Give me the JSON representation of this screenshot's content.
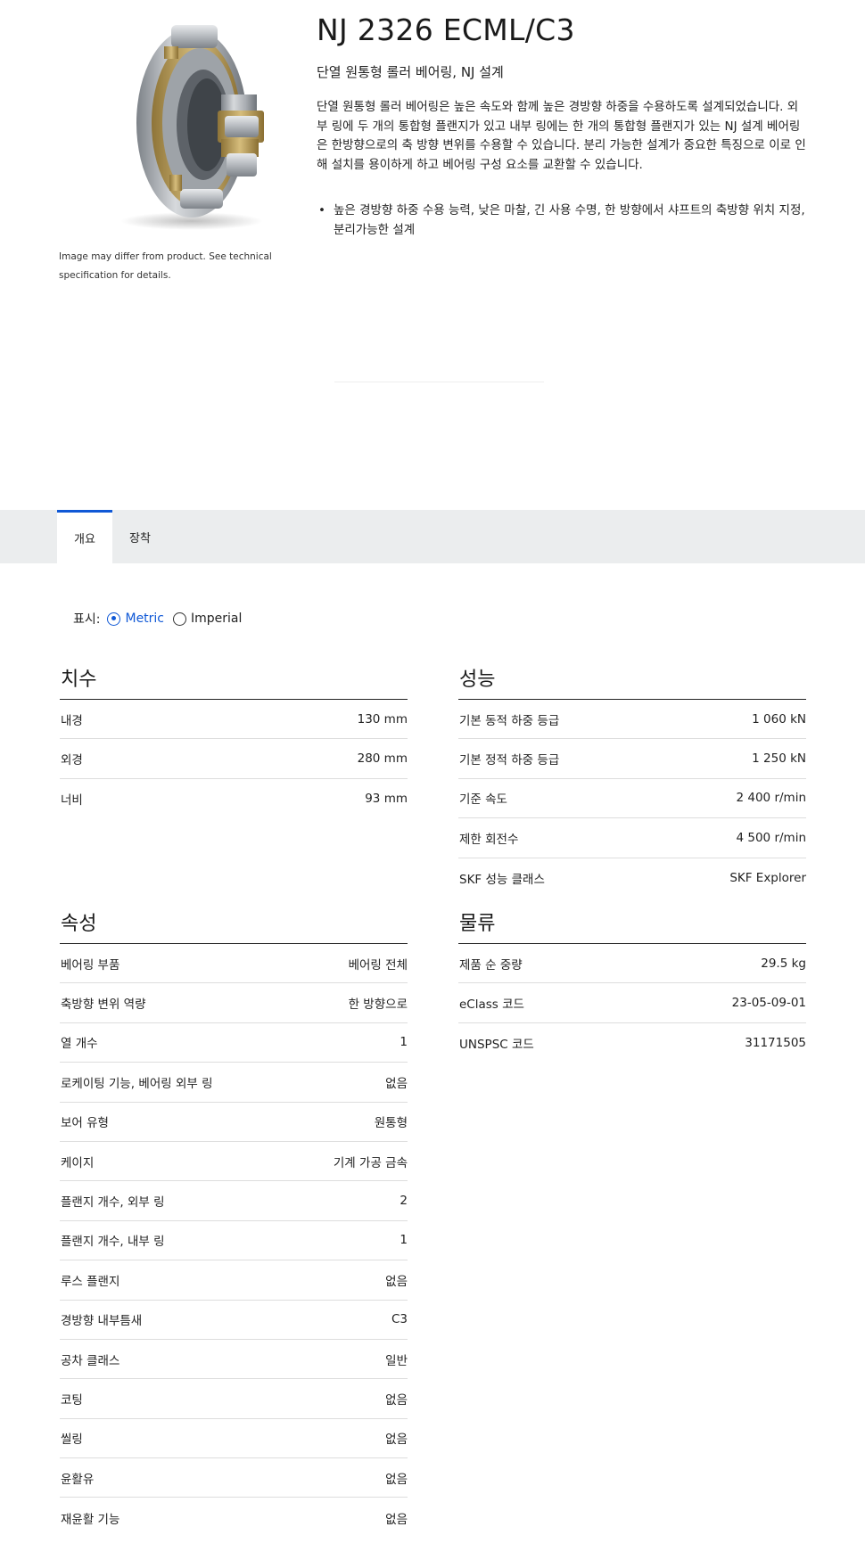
{
  "product": {
    "title": "NJ 2326 ECML/C3",
    "subtitle": "단열 원통형 롤러 베어링, NJ 설계",
    "description": "단열 원통형 롤러 베어링은 높은 속도와 함께 높은 경방향 하중을 수용하도록 설계되었습니다. 외부 링에 두 개의 통합형 플랜지가 있고 내부 링에는 한 개의 통합형 플랜지가 있는 NJ 설계 베어링은 한방향으로의 축 방향 변위를 수용할 수 있습니다. 분리 가능한 설계가 중요한 특징으로 이로 인해 설치를 용이하게 하고 베어링 구성 요소를 교환할 수 있습니다.",
    "benefits": [
      "높은 경방향 하중 수용 능력, 낮은 마찰, 긴 사용 수명, 한 방향에서 샤프트의 축방향 위치 지정, 분리가능한 설계"
    ],
    "image_note": "Image may differ from product. See technical specification for details."
  },
  "tabs": [
    {
      "label": "개요",
      "active": true
    },
    {
      "label": "장착",
      "active": false
    }
  ],
  "units": {
    "label": "표시:",
    "options": [
      "Metric",
      "Imperial"
    ],
    "selected": "Metric"
  },
  "sections": {
    "dimensions": {
      "title": "치수",
      "rows": [
        {
          "name": "내경",
          "value": "130 mm"
        },
        {
          "name": "외경",
          "value": "280 mm"
        },
        {
          "name": "너비",
          "value": "93 mm"
        }
      ]
    },
    "performance": {
      "title": "성능",
      "rows": [
        {
          "name": "기본 동적 하중 등급",
          "value": "1 060 kN"
        },
        {
          "name": "기본 정적 하중 등급",
          "value": "1 250 kN"
        },
        {
          "name": "기준 속도",
          "value": "2 400 r/min"
        },
        {
          "name": "제한 회전수",
          "value": "4 500 r/min"
        },
        {
          "name": "SKF 성능 클래스",
          "value": "SKF Explorer"
        }
      ]
    },
    "properties": {
      "title": "속성",
      "rows": [
        {
          "name": "베어링 부품",
          "value": "베어링 전체"
        },
        {
          "name": "축방향 변위 역량",
          "value": "한 방향으로"
        },
        {
          "name": "열 개수",
          "value": "1"
        },
        {
          "name": "로케이팅 기능, 베어링 외부 링",
          "value": "없음"
        },
        {
          "name": "보어 유형",
          "value": "원통형"
        },
        {
          "name": "케이지",
          "value": "기계 가공 금속"
        },
        {
          "name": "플랜지 개수, 외부 링",
          "value": "2"
        },
        {
          "name": "플랜지 개수, 내부 링",
          "value": "1"
        },
        {
          "name": "루스 플랜지",
          "value": "없음"
        },
        {
          "name": "경방향 내부틈새",
          "value": "C3"
        },
        {
          "name": "공차 클래스",
          "value": "일반"
        },
        {
          "name": "코팅",
          "value": "없음"
        },
        {
          "name": "씰링",
          "value": "없음"
        },
        {
          "name": "윤활유",
          "value": "없음"
        },
        {
          "name": "재윤활 기능",
          "value": "없음"
        }
      ]
    },
    "logistics": {
      "title": "물류",
      "rows": [
        {
          "name": "제품 순 중량",
          "value": "29.5 kg"
        },
        {
          "name": "eClass 코드",
          "value": "23-05-09-01"
        },
        {
          "name": "UNSPSC 코드",
          "value": "31171505"
        }
      ]
    }
  },
  "colors": {
    "accent": "#0f58d6",
    "tabbar_bg": "#ebedee",
    "text": "#222222",
    "divider": "#dddddd",
    "brass_cage": "#b99a52",
    "steel": "#b8bcc1"
  },
  "icons": {
    "product_image": "cylindrical-roller-bearing-illustration",
    "bullet": "bullet-icon",
    "radio_selected": "radio-checked-icon",
    "radio_unselected": "radio-unchecked-icon"
  }
}
